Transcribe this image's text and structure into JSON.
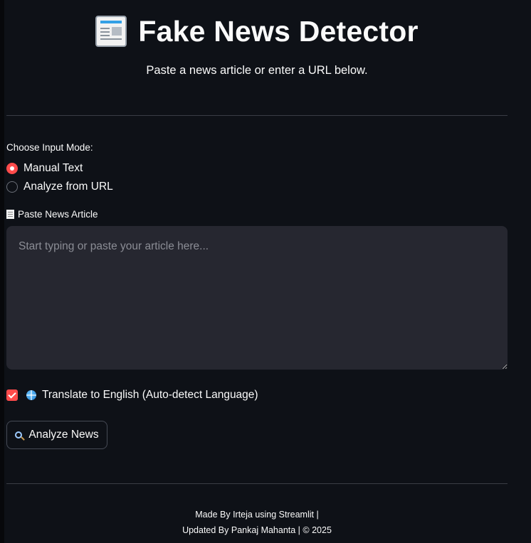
{
  "header": {
    "title": "Fake News Detector",
    "icon": "newspaper-icon",
    "subtitle": "Paste a news article or enter a URL below."
  },
  "input_mode": {
    "label": "Choose Input Mode:",
    "options": [
      {
        "label": "Manual Text",
        "selected": true
      },
      {
        "label": "Analyze from URL",
        "selected": false
      }
    ]
  },
  "article": {
    "label": "Paste News Article",
    "label_icon": "page-icon",
    "value": "",
    "placeholder": "Start typing or paste your article here..."
  },
  "translate": {
    "label": "Translate to English (Auto-detect Language)",
    "checked": true,
    "icon": "globe-icon"
  },
  "analyze_button": {
    "label": "Analyze News",
    "icon": "magnifier-icon"
  },
  "footer": {
    "line1": "Made By Irteja using Streamlit |",
    "line2": "Updated By Pankaj Mahanta | © 2025"
  },
  "colors": {
    "background": "#0e1117",
    "accent": "#ff4b4b",
    "input_bg": "#262730",
    "text": "#fafafa"
  }
}
